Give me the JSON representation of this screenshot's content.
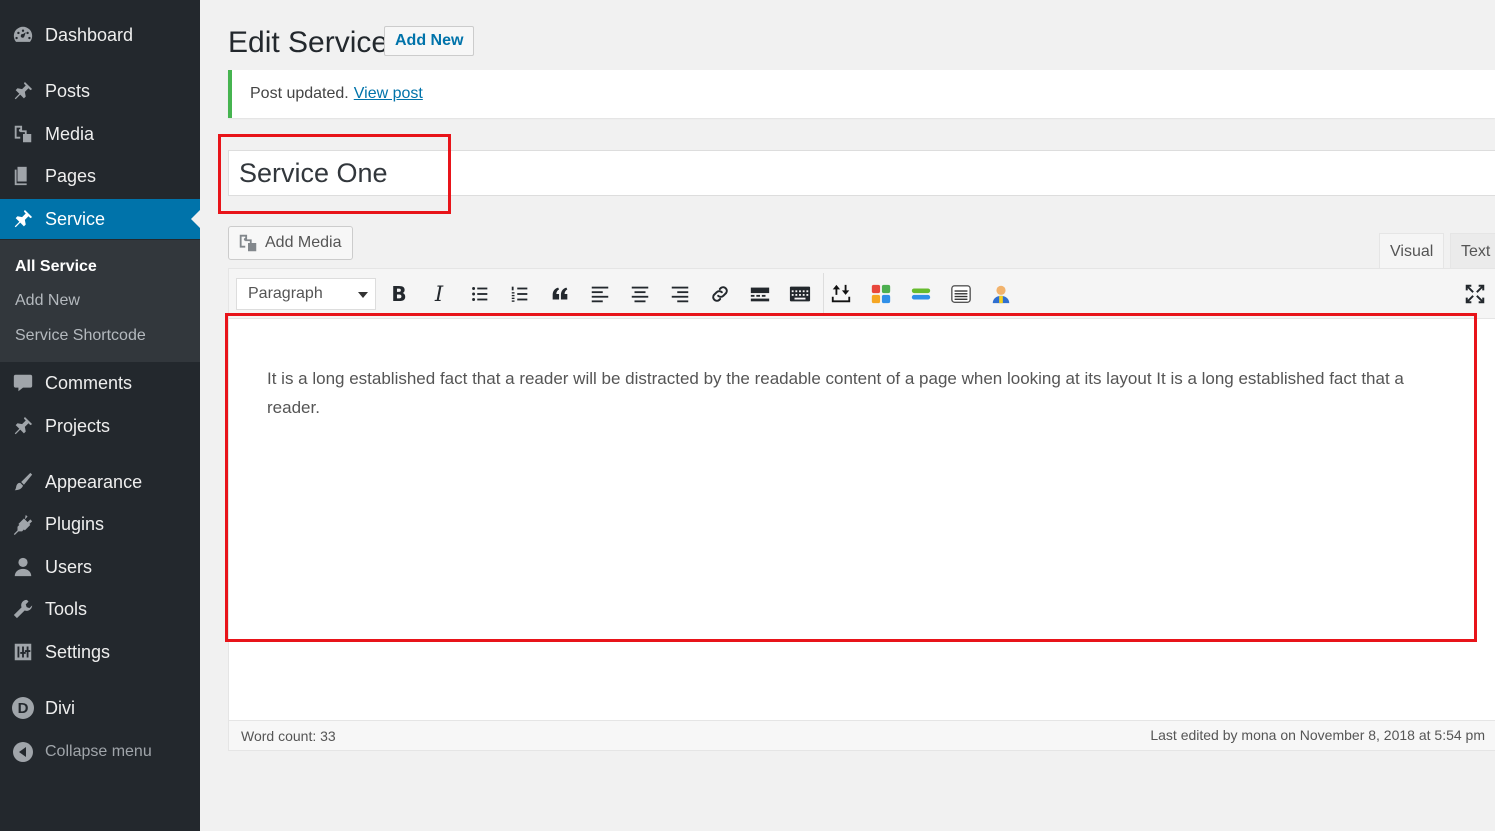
{
  "sidebar": {
    "items": [
      {
        "label": "Dashboard",
        "icon": "dashboard-icon"
      },
      {
        "label": "Posts",
        "icon": "pin-icon"
      },
      {
        "label": "Media",
        "icon": "media-icon"
      },
      {
        "label": "Pages",
        "icon": "pages-icon"
      },
      {
        "label": "Service",
        "icon": "pin-icon"
      },
      {
        "label": "Comments",
        "icon": "comments-icon"
      },
      {
        "label": "Projects",
        "icon": "pin-icon"
      },
      {
        "label": "Appearance",
        "icon": "brush-icon"
      },
      {
        "label": "Plugins",
        "icon": "plug-icon"
      },
      {
        "label": "Users",
        "icon": "user-icon"
      },
      {
        "label": "Tools",
        "icon": "wrench-icon"
      },
      {
        "label": "Settings",
        "icon": "settings-icon"
      },
      {
        "label": "Divi",
        "icon": "divi-icon"
      },
      {
        "label": "Collapse menu",
        "icon": "collapse-icon"
      }
    ],
    "submenu": [
      "All Service",
      "Add New",
      "Service Shortcode"
    ],
    "colors": {
      "background": "#23282d",
      "active": "#0073aa",
      "submenu": "#32373c"
    }
  },
  "header": {
    "title": "Edit Service",
    "add_new_label": "Add New"
  },
  "notice": {
    "text": "Post updated.",
    "link": "View post",
    "border_color": "#46b450"
  },
  "post": {
    "title": "Service One"
  },
  "editor": {
    "add_media_label": "Add Media",
    "tabs": {
      "visual": "Visual",
      "text": "Text"
    },
    "format_select": "Paragraph",
    "toolbar_buttons": [
      "bold-icon",
      "italic-icon",
      "bullet-list-icon",
      "numbered-list-icon",
      "blockquote-icon",
      "align-left-icon",
      "align-center-icon",
      "align-right-icon",
      "link-icon",
      "read-more-icon",
      "toolbar-toggle-icon",
      "upload-icon",
      "grid-icon",
      "stack-icon",
      "document-icon",
      "person-icon",
      "fullscreen-icon"
    ],
    "content": "It is a long established fact that a reader will be distracted by the readable content of a page when looking at its layout It is a long established fact that a reader.",
    "status": {
      "word_count": "Word count: 33",
      "last_edited": "Last edited by mona on November 8, 2018 at 5:54 pm"
    }
  },
  "highlight_color": "#e8141a"
}
